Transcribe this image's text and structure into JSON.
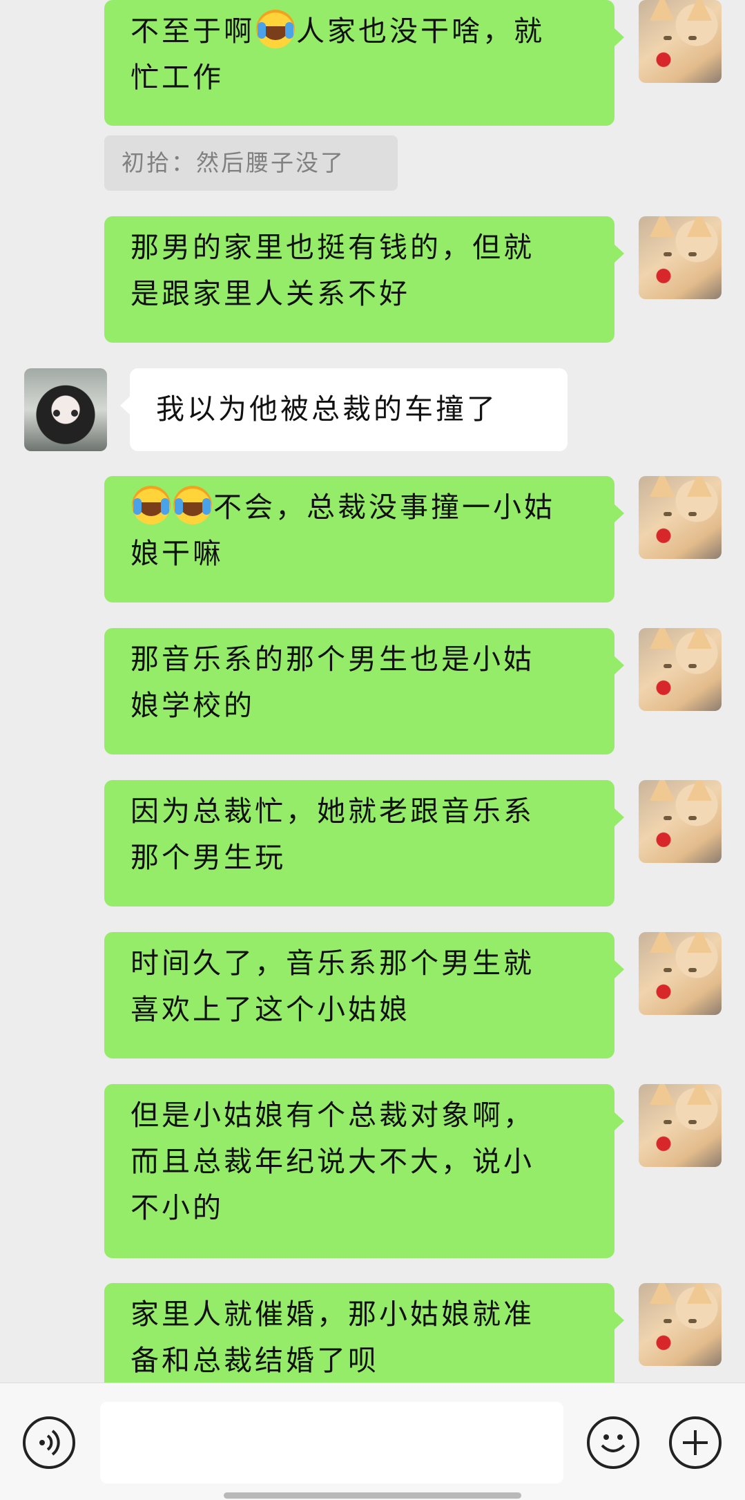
{
  "messages": [
    {
      "id": "m1",
      "side": "me",
      "parts": [
        "不至于啊",
        "emoji-cry",
        "人家也没干啥，就忙工作"
      ]
    },
    {
      "id": "q1",
      "type": "quote",
      "text": "初拾：然后腰子没了"
    },
    {
      "id": "m2",
      "side": "me",
      "text": "那男的家里也挺有钱的，但就是跟家里人关系不好"
    },
    {
      "id": "m3",
      "side": "them",
      "text": "我以为他被总裁的车撞了"
    },
    {
      "id": "m4",
      "side": "me",
      "text": "不会，总裁没事撞一小姑娘干嘛"
    },
    {
      "id": "m5",
      "side": "me",
      "text": "那音乐系的那个男生也是小姑娘学校的"
    },
    {
      "id": "m6",
      "side": "me",
      "text": "因为总裁忙，她就老跟音乐系那个男生玩"
    },
    {
      "id": "m7",
      "side": "me",
      "text": "时间久了，音乐系那个男生就喜欢上了这个小姑娘"
    },
    {
      "id": "m8",
      "side": "me",
      "text": "但是小姑娘有个总裁对象啊，而且总裁年纪说大不大，说小不小的"
    },
    {
      "id": "m9",
      "side": "me",
      "text": "家里人就催婚，那小姑娘就准备和总裁结婚了呗"
    }
  ],
  "m1a": "不至于啊",
  "m1b": "人家也没干啥，就",
  "m1c": "忙工作",
  "m2a": "那男的家里也挺有钱的，但就",
  "m2b": "是跟家里人关系不好",
  "m4a": "不会，总裁没事撞一小姑",
  "m4b": "娘干嘛",
  "m5a": "那音乐系的那个男生也是小姑",
  "m5b": "娘学校的",
  "m6a": "因为总裁忙，她就老跟音乐系",
  "m6b": "那个男生玩",
  "m7a": "时间久了，音乐系那个男生就",
  "m7b": "喜欢上了这个小姑娘",
  "m8a": "但是小姑娘有个总裁对象啊，",
  "m8b": "而且总裁年纪说大不大，说小",
  "m8c": "不小的",
  "m9a": "家里人就催婚，那小姑娘就准",
  "m9b": "备和总裁结婚了呗",
  "icons": {
    "voice": "voice-icon",
    "emoji": "emoji-icon",
    "plus": "plus-icon"
  },
  "colors": {
    "my_bubble": "#95ec69",
    "their_bubble": "#ffffff",
    "background": "#ededed"
  }
}
